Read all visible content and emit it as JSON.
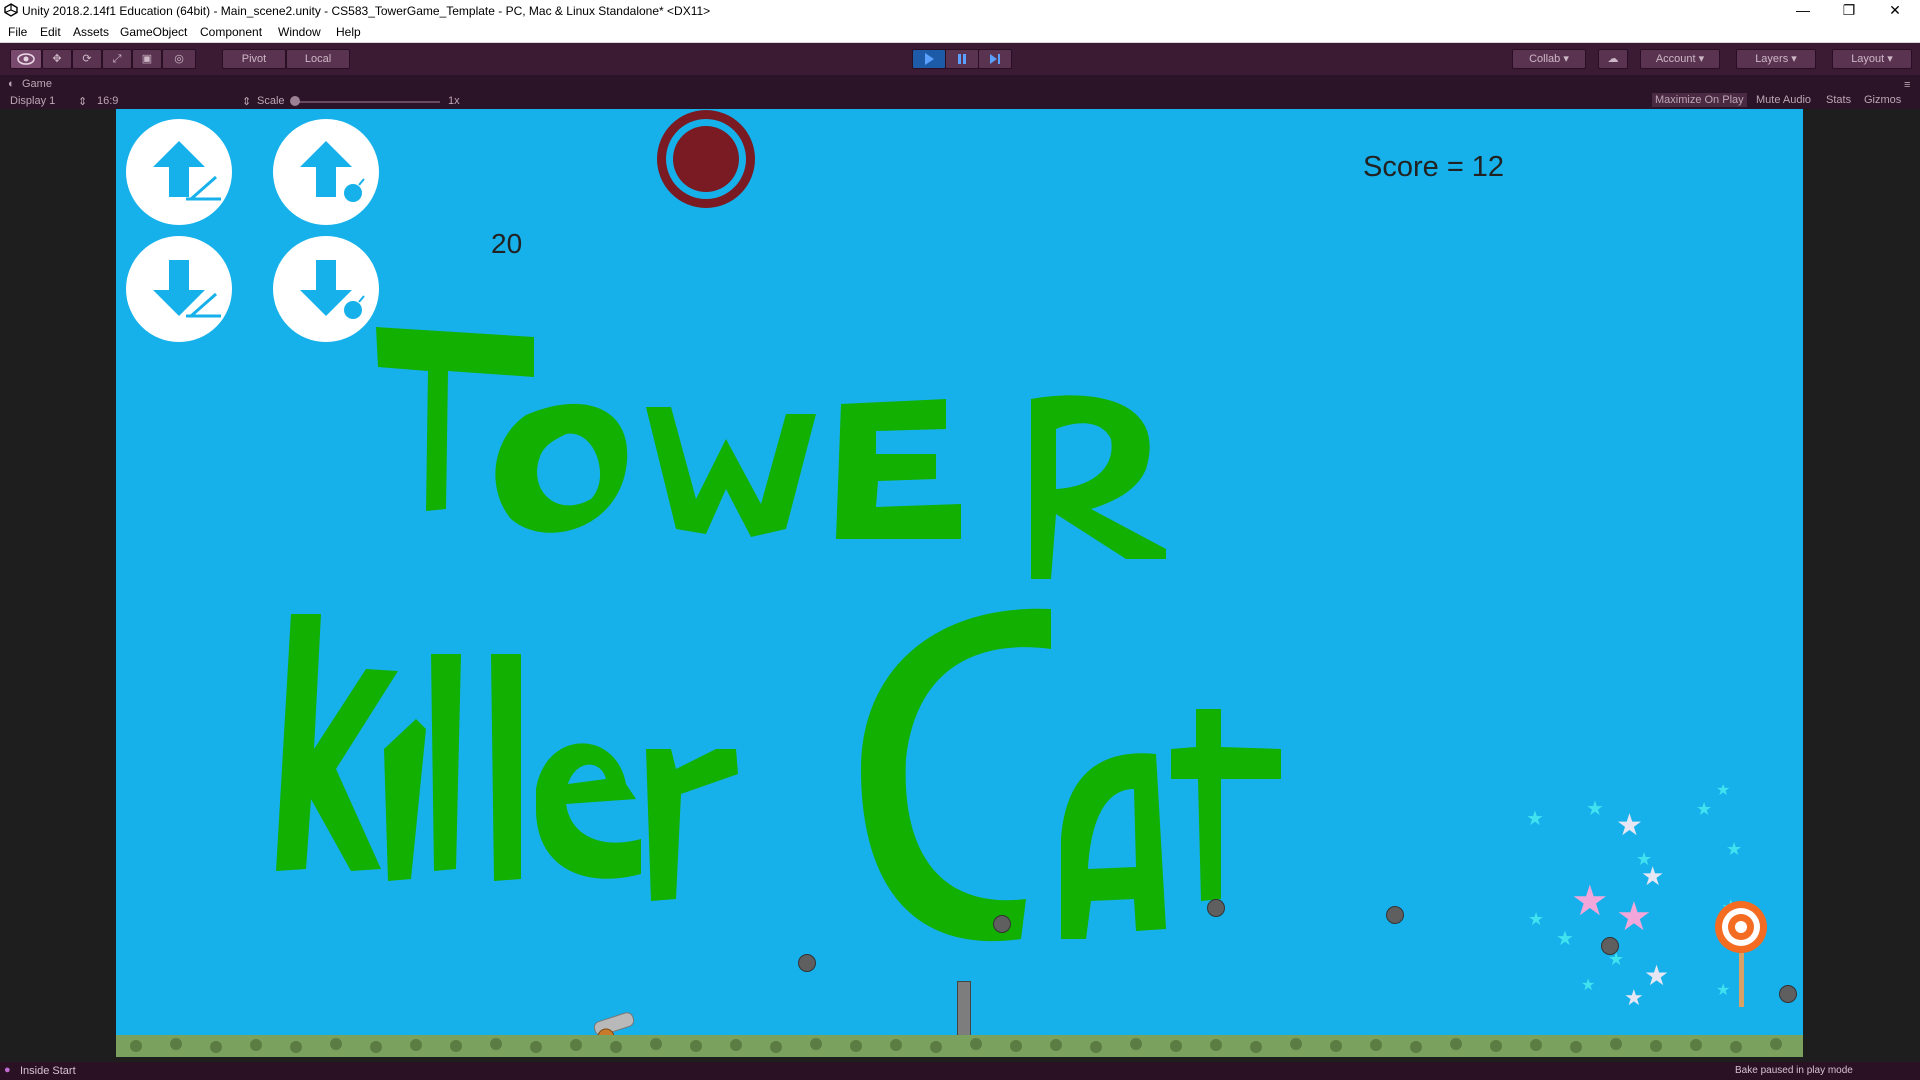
{
  "window": {
    "title": "Unity 2018.2.14f1 Education (64bit) - Main_scene2.unity - CS583_TowerGame_Template - PC, Mac & Linux Standalone* <DX11>",
    "minimize_icon": "minimize-icon",
    "maximize_icon": "restore-icon",
    "close_icon": "close-icon"
  },
  "menu": [
    "File",
    "Edit",
    "Assets",
    "GameObject",
    "Component",
    "Window",
    "Help"
  ],
  "toolbar": {
    "tools": [
      "view-tool-icon",
      "move-tool-icon",
      "rotate-tool-icon",
      "scale-tool-icon",
      "rect-tool-icon",
      "transform-tool-icon"
    ],
    "pivot_label": "Pivot",
    "local_label": "Local",
    "play_icon": "play-icon",
    "pause_icon": "pause-icon",
    "step_icon": "step-icon",
    "collab_label": "Collab",
    "account_label": "Account",
    "layers_label": "Layers",
    "layout_label": "Layout"
  },
  "game_tab": {
    "label": "Game",
    "display": "Display 1",
    "aspect": "16:9",
    "scale_label": "Scale",
    "scale_value": "1x",
    "maximize_on_play": "Maximize On Play",
    "mute_audio": "Mute Audio",
    "stats": "Stats",
    "gizmos": "Gizmos"
  },
  "game": {
    "score_text": "Score = 12",
    "counter": "20",
    "title_line1": "TOWER",
    "title_line2": "Killer Cat",
    "buttons": [
      {
        "name": "angle-up-button",
        "icon": "arrow-up-angle-icon"
      },
      {
        "name": "power-up-button",
        "icon": "arrow-up-bomb-icon"
      },
      {
        "name": "angle-down-button",
        "icon": "arrow-down-angle-icon"
      },
      {
        "name": "power-down-button",
        "icon": "arrow-down-bomb-icon"
      }
    ],
    "colors": {
      "sky": "#16b1ea",
      "title_green": "#12b000",
      "target_dark": "#7a1a22",
      "button_white": "#ffffff"
    }
  },
  "status": {
    "left": "Inside Start",
    "right": "Bake paused in play mode"
  }
}
